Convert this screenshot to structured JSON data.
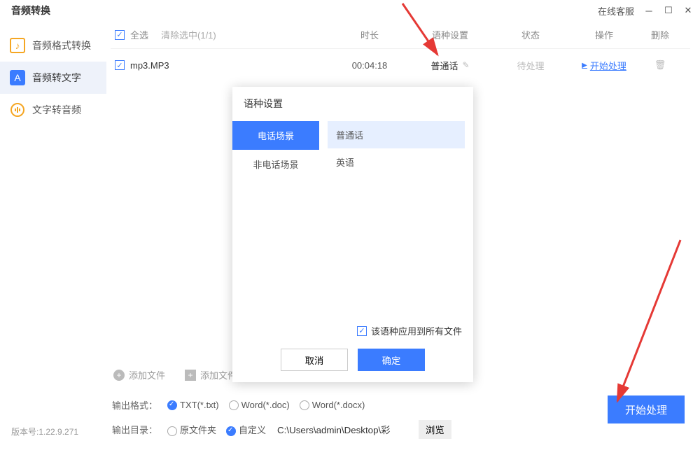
{
  "titlebar": {
    "title": "音频转换",
    "online": "在线客服"
  },
  "sidebar": {
    "items": [
      {
        "label": "音频格式转换"
      },
      {
        "label": "音频转文字"
      },
      {
        "label": "文字转音频"
      }
    ]
  },
  "list": {
    "select_all": "全选",
    "clear": "清除选中(1/1)",
    "headers": {
      "duration": "时长",
      "lang": "语种设置",
      "status": "状态",
      "op": "操作",
      "del": "删除"
    },
    "rows": [
      {
        "file": "mp3.MP3",
        "duration": "00:04:18",
        "lang": "普通话",
        "status": "待处理",
        "op": "开始处理"
      }
    ]
  },
  "add": {
    "file": "添加文件",
    "folder": "添加文件夹"
  },
  "output_format": {
    "label": "输出格式：",
    "options": [
      {
        "label": "TXT(*.txt)"
      },
      {
        "label": "Word(*.doc)"
      },
      {
        "label": "Word(*.docx)"
      }
    ]
  },
  "output_dir": {
    "label": "输出目录：",
    "src": "原文件夹",
    "custom": "自定义",
    "path": "C:\\Users\\admin\\Desktop\\彩",
    "browse": "浏览"
  },
  "start": "开始处理",
  "version": "版本号:1.22.9.271",
  "modal": {
    "title": "语种设置",
    "tabs": [
      {
        "label": "电话场景"
      },
      {
        "label": "非电话场景"
      }
    ],
    "options": [
      {
        "label": "普通话"
      },
      {
        "label": "英语"
      }
    ],
    "apply_all": "该语种应用到所有文件",
    "cancel": "取消",
    "ok": "确定"
  }
}
